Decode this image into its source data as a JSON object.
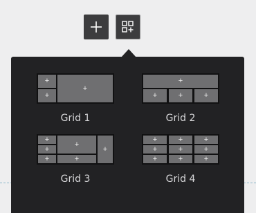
{
  "toolbar": {
    "add_label": "+",
    "add_icon": "plus-icon",
    "grid_icon": "grid-add-icon"
  },
  "panel": {
    "options": [
      {
        "label": "Grid 1",
        "cell_label": "+"
      },
      {
        "label": "Grid 2",
        "cell_label": "+"
      },
      {
        "label": "Grid 3",
        "cell_label": "+"
      },
      {
        "label": "Grid 4",
        "cell_label": "+"
      }
    ]
  },
  "colors": {
    "panel_background": "#222224",
    "cell_fill": "#6f6f71",
    "page_background": "#eeeeef"
  }
}
